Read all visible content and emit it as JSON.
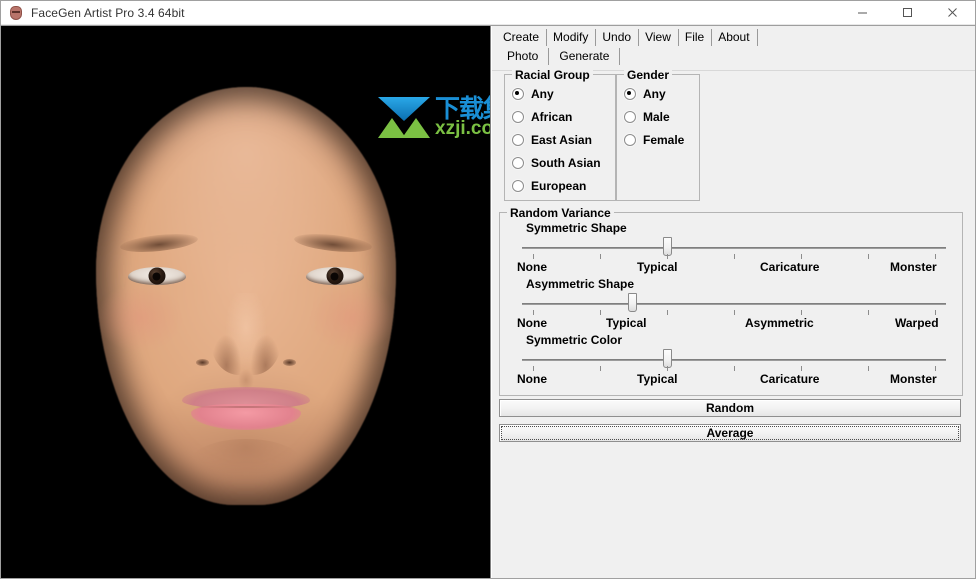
{
  "window": {
    "title": "FaceGen Artist Pro 3.4 64bit",
    "icon": "facegen-head-icon",
    "controls": {
      "minimize": "─",
      "maximize": "□",
      "close": "✕"
    }
  },
  "menu": {
    "items": [
      {
        "label": "Create",
        "active": true
      },
      {
        "label": "Modify",
        "active": false
      },
      {
        "label": "Undo",
        "active": false
      },
      {
        "label": "View",
        "active": false
      },
      {
        "label": "File",
        "active": false
      },
      {
        "label": "About",
        "active": false
      }
    ]
  },
  "tabs": {
    "items": [
      {
        "label": "Photo",
        "active": false
      },
      {
        "label": "Generate",
        "active": true
      }
    ]
  },
  "racial_group": {
    "legend": "Racial Group",
    "options": [
      {
        "label": "Any",
        "checked": true
      },
      {
        "label": "African",
        "checked": false
      },
      {
        "label": "East Asian",
        "checked": false
      },
      {
        "label": "South Asian",
        "checked": false
      },
      {
        "label": "European",
        "checked": false
      }
    ]
  },
  "gender": {
    "legend": "Gender",
    "options": [
      {
        "label": "Any",
        "checked": true
      },
      {
        "label": "Male",
        "checked": false
      },
      {
        "label": "Female",
        "checked": false
      }
    ]
  },
  "random_variance": {
    "legend": "Random Variance",
    "sliders": [
      {
        "title": "Symmetric Shape",
        "ticks": 7,
        "value_index": 3,
        "labels": [
          "None",
          "Typical",
          "Caricature",
          "Monster"
        ],
        "label_tick_positions": [
          1,
          3,
          5,
          7
        ]
      },
      {
        "title": "Asymmetric Shape",
        "ticks": 7,
        "value_index": 2,
        "labels": [
          "None",
          "Typical",
          "Asymmetric",
          "Warped"
        ],
        "label_tick_positions": [
          1,
          3,
          5,
          7
        ]
      },
      {
        "title": "Symmetric Color",
        "ticks": 7,
        "value_index": 3,
        "labels": [
          "None",
          "Typical",
          "Caricature",
          "Monster"
        ],
        "label_tick_positions": [
          1,
          3,
          5,
          7
        ]
      }
    ]
  },
  "buttons": {
    "random": "Random",
    "average": "Average"
  },
  "watermark": {
    "chinese": "下载集",
    "site": "xzji.com",
    "logo_blue": "#1a8fd6",
    "logo_green": "#7bc043"
  },
  "viewport": {
    "background": "#000000",
    "render": "generated-face-render"
  }
}
